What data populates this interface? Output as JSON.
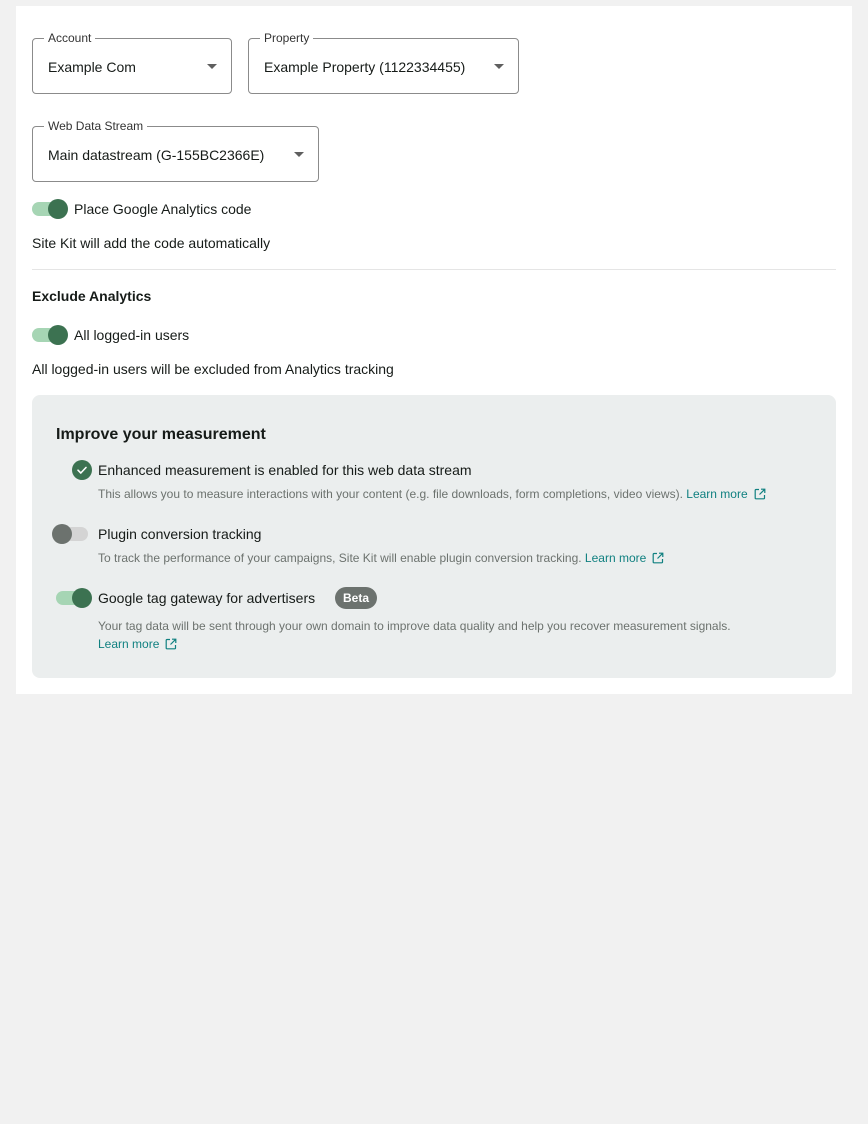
{
  "selects": {
    "account": {
      "label": "Account",
      "value": "Example Com"
    },
    "property": {
      "label": "Property",
      "value": "Example Property (1122334455)"
    },
    "stream": {
      "label": "Web Data Stream",
      "value": "Main datastream (G-155BC2366E)"
    }
  },
  "place_code": {
    "label": "Place Google Analytics code",
    "enabled": true,
    "help": "Site Kit will add the code automatically"
  },
  "exclude": {
    "heading": "Exclude Analytics",
    "toggle_label": "All logged-in users",
    "enabled": true,
    "help": "All logged-in users will be excluded from Analytics tracking"
  },
  "improve": {
    "title": "Improve your measurement",
    "enhanced": {
      "label": "Enhanced measurement is enabled for this web data stream",
      "description": "This allows you to measure interactions with your content (e.g. file downloads, form completions, video views).",
      "link": "Learn more",
      "icon": "check-circle-icon"
    },
    "plugin": {
      "label": "Plugin conversion tracking",
      "enabled": false,
      "description": "To track the performance of your campaigns, Site Kit will enable plugin conversion tracking.",
      "link": "Learn more"
    },
    "gateway": {
      "label": "Google tag gateway for advertisers",
      "badge": "Beta",
      "enabled": true,
      "description": "Your tag data will be sent through your own domain to improve data quality and help you recover measurement signals.",
      "link": "Learn more"
    }
  },
  "colors": {
    "accent": "#3c7251",
    "toggle_track_on": "#a6d5b4",
    "link": "#108080",
    "panel_bg": "#ebeeee",
    "page_bg": "#f1f1f1"
  }
}
